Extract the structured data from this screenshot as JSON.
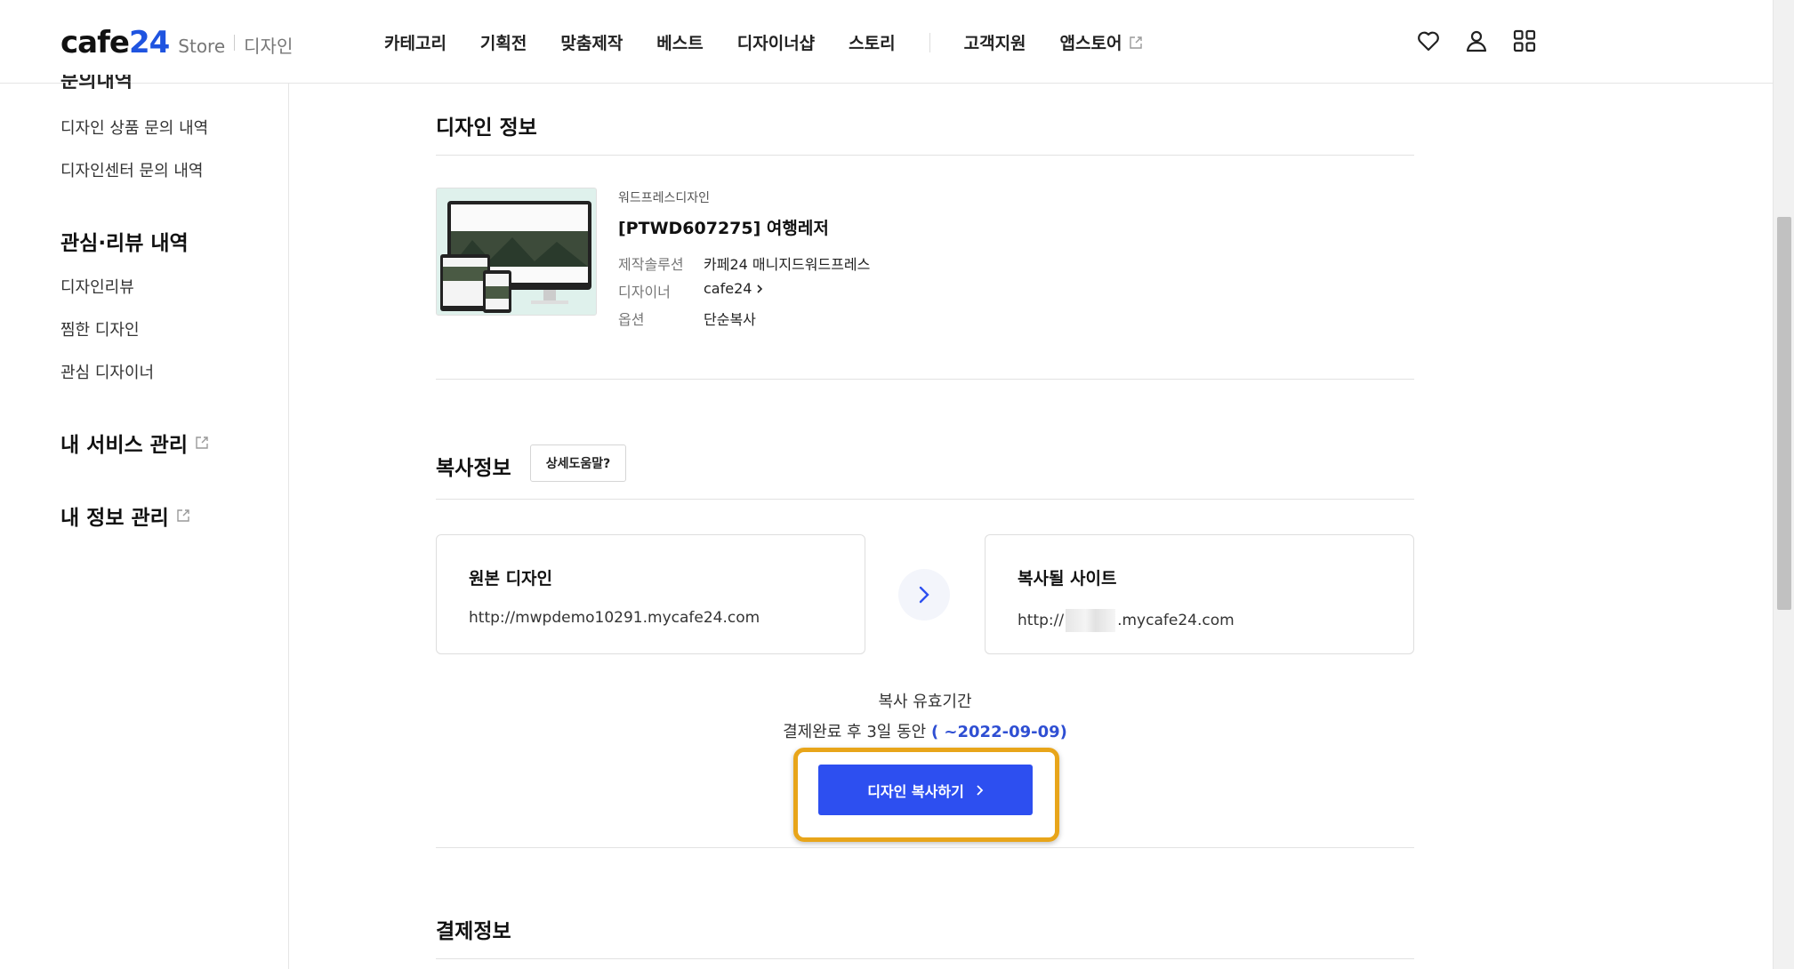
{
  "header": {
    "logo_main": "cafe",
    "logo_num": "24",
    "logo_store": "Store",
    "logo_sub": "디자인",
    "nav": [
      "카테고리",
      "기획전",
      "맞춤제작",
      "베스트",
      "디자이너샵",
      "스토리"
    ],
    "nav_right": [
      "고객지원",
      "앱스토어"
    ],
    "icons": [
      "heart-icon",
      "user-icon",
      "grid-icon"
    ]
  },
  "sidebar": {
    "cut_heading": "문의내역",
    "inquiry_items": [
      "디자인 상품 문의 내역",
      "디자인센터 문의 내역"
    ],
    "section_interest": "관심·리뷰 내역",
    "interest_items": [
      "디자인리뷰",
      "찜한 디자인",
      "관심 디자이너"
    ],
    "service": "내 서비스 관리",
    "info": "내 정보 관리"
  },
  "design_info": {
    "title": "디자인 정보",
    "category": "워드프레스디자인",
    "name": "[PTWD607275] 여행레저",
    "meta": [
      {
        "label": "제작솔루션",
        "value": "카페24 매니지드워드프레스"
      },
      {
        "label": "디자이너",
        "value": "cafe24"
      },
      {
        "label": "옵션",
        "value": "단순복사"
      }
    ]
  },
  "copy_info": {
    "title": "복사정보",
    "help_label": "상세도움말?",
    "source": {
      "title": "원본 디자인",
      "url": "http://mwpdemo10291.mycafe24.com"
    },
    "target": {
      "title": "복사될 사이트",
      "url_prefix": "http://",
      "url_suffix": ".mycafe24.com"
    },
    "validity_title": "복사 유효기간",
    "validity_text": "결제완료 후 3일 동안",
    "validity_date": "( ~2022-09-09)",
    "button_label": "디자인 복사하기"
  },
  "payment": {
    "title": "결제정보"
  },
  "colors": {
    "brand": "#1f54e0",
    "button": "#2d4ff0",
    "highlight": "#e8a51a",
    "date": "#2f4fd3"
  }
}
